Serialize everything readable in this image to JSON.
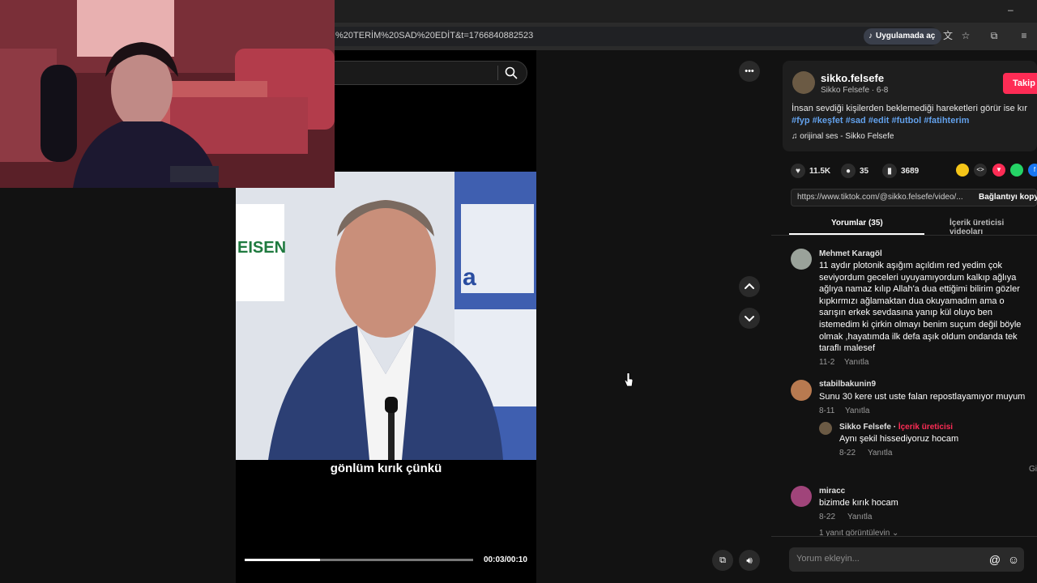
{
  "browser": {
    "url": "%20TERİM%20SAD%20EDİT&t=1766840882523",
    "open_app_label": "Uygulamada aç",
    "minimize": "–"
  },
  "player": {
    "caption": "gönlüm kırık çünkü",
    "time": "00:03/00:10",
    "progress_percent": 33,
    "more_icon": "•••",
    "nav_up_icon": "chevron-up-icon",
    "nav_down_icon": "chevron-down-icon"
  },
  "post": {
    "username": "sikko.felsefe",
    "subname": "Sikko Felsefe · 6-8",
    "follow_label": "Takip",
    "description": "İnsan sevdiği kişilerden beklemediği hareketleri görür ise kır",
    "hashtags": "#fyp #keşfet #sad #edit #futbol #fatihterim",
    "music": "orijinal ses - Sikko Felsefe",
    "likes": "11.5K",
    "comments": "35",
    "saves": "3689",
    "link": "https://www.tiktok.com/@sikko.felsefe/video/...",
    "copy_link_label": "Bağlantıyı kopy"
  },
  "tabs": [
    {
      "label": "Yorumlar (35)"
    },
    {
      "label": "İçerik üreticisi videoları"
    }
  ],
  "comments": [
    {
      "author": "Mehmet Karagöl",
      "lines": [
        "11 aydır plotonik aşığım açıldım red yedim çok",
        "seviyordum geceleri uyuyamıyordum kalkıp ağlıya",
        "ağlıya namaz kılıp Allah'a dua ettiğimi bilirim gözler",
        "kıpkırmızı ağlamaktan dua okuyamadım ama o",
        "sarışın erkek sevdasına yanıp kül oluyo ben",
        "istemedim ki çirkin olmayı benim suçum değil böyle",
        "olmak ,hayatımda ilk defa aşık oldum ondanda tek",
        "taraflı malesef"
      ],
      "date": "11-2",
      "reply_label": "Yanıtla"
    },
    {
      "author": "stabilbakunin9",
      "lines": [
        "Sunu 30 kere ust uste falan repostlayamıyor muyum"
      ],
      "date": "8-11",
      "reply_label": "Yanıtla",
      "reply": {
        "author": "Sikko Felsefe",
        "badge": "İçerik üreticisi",
        "text": "Aynı şekil hissediyoruz hocam",
        "date": "8-22",
        "reply_label": "Yanıtla"
      }
    },
    {
      "author": "miracc",
      "lines": [
        "bizimde kırık hocam"
      ],
      "date": "8-22",
      "reply_label": "Yanıtla",
      "view_replies": "1 yanıt görüntülevin"
    }
  ],
  "side_hint": "Gi",
  "comment_input": {
    "placeholder": "Yorum ekleyin..."
  },
  "colors": {
    "accent": "#fe2c55",
    "hashtag": "#62a0ea",
    "panel_bg": "#121212"
  }
}
